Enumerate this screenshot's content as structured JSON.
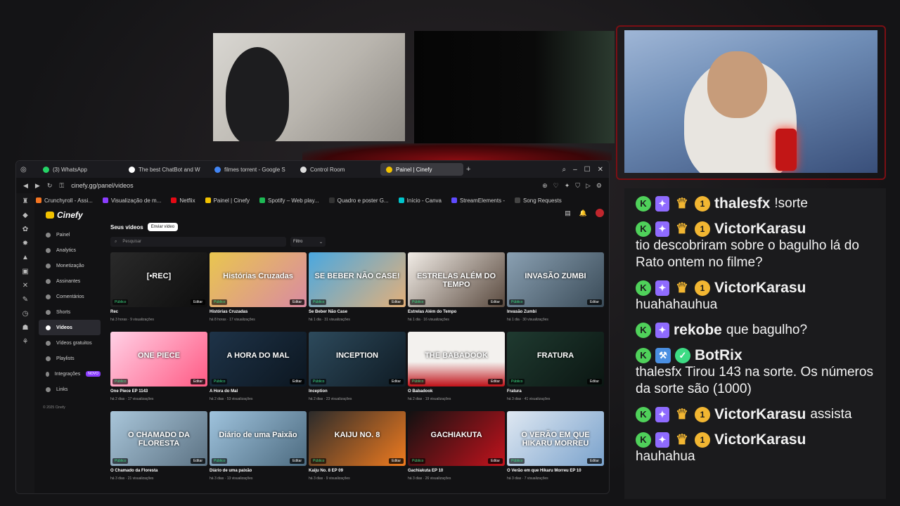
{
  "browser": {
    "tabs": [
      {
        "label": "(3) WhatsApp",
        "color": "#25d366"
      },
      {
        "label": "The best ChatBot and W",
        "color": "#ffffff"
      },
      {
        "label": "filmes torrent - Google S",
        "color": "#4285f4"
      },
      {
        "label": "Control Room",
        "color": "#dddddd"
      },
      {
        "label": "Painel | Cinefy",
        "color": "#f2c200"
      }
    ],
    "url": "cinefy.gg/panel/videos",
    "bookmarks": [
      {
        "label": "Crunchyroll - Assi...",
        "color": "#f47521"
      },
      {
        "label": "Visualização de m...",
        "color": "#8b3dff"
      },
      {
        "label": "Netflix",
        "color": "#e50914"
      },
      {
        "label": "Painel | Cinefy",
        "color": "#f2c200"
      },
      {
        "label": "Spotify – Web play...",
        "color": "#1db954"
      },
      {
        "label": "Quadro e poster G...",
        "color": "#333333"
      },
      {
        "label": "Início - Canva",
        "color": "#00c4cc"
      },
      {
        "label": "StreamElements -",
        "color": "#5f4bff"
      },
      {
        "label": "Song Requests",
        "color": "#444444"
      }
    ]
  },
  "app": {
    "logo": "Cinefy",
    "nav": [
      {
        "label": "Painel"
      },
      {
        "label": "Analytics"
      },
      {
        "label": "Monetização"
      },
      {
        "label": "Assinantes"
      },
      {
        "label": "Comentários"
      },
      {
        "label": "Shorts"
      },
      {
        "label": "Vídeos"
      },
      {
        "label": "Vídeos gratuitos"
      },
      {
        "label": "Playlists"
      },
      {
        "label": "Integrações"
      },
      {
        "label": "Links"
      }
    ],
    "new_badge": "NOVO",
    "copyright": "© 2025 Cinefy",
    "section_title": "Seus vídeos",
    "send_button": "Enviar vídeo",
    "search_placeholder": "Pesquisar",
    "filter_label": "Filtro",
    "public_label": "Público",
    "edit_label": "Editar",
    "videos": [
      {
        "title": "Rec",
        "meta": "há 3 horas · 9 visualizações",
        "overlay": "[•REC]",
        "bg": "linear-gradient(135deg,#2a2a2a,#0e0e0e)"
      },
      {
        "title": "Histórias Cruzadas",
        "meta": "há 8 horas · 17 visualizações",
        "overlay": "Histórias Cruzadas",
        "bg": "linear-gradient(135deg,#e9c64f,#d98aa2)"
      },
      {
        "title": "Se Beber Não Case",
        "meta": "há 1 dia · 31 visualizações",
        "overlay": "SE BEBER NÃO CASE!",
        "bg": "linear-gradient(135deg,#4aa8e0,#e3b07a)"
      },
      {
        "title": "Estrelas Além do Tempo",
        "meta": "há 1 dia · 16 visualizações",
        "overlay": "ESTRELAS ALÉM DO TEMPO",
        "bg": "linear-gradient(135deg,#f1ece6,#5a4a3f)"
      },
      {
        "title": "Invasão Zumbi",
        "meta": "há 1 dia · 30 visualizações",
        "overlay": "INVASÃO ZUMBI",
        "bg": "linear-gradient(135deg,#8aa0b2,#3a4b58)"
      },
      {
        "title": "One Piece EP 1143",
        "meta": "há 2 dias · 17 visualizações",
        "overlay": "ONE PIECE",
        "bg": "linear-gradient(135deg,#ffd1e6,#ff5a84)"
      },
      {
        "title": "A Hora do Mal",
        "meta": "há 2 dias · 53 visualizações",
        "overlay": "A HORA DO MAL",
        "bg": "linear-gradient(135deg,#1e3348,#0c1620)"
      },
      {
        "title": "Inception",
        "meta": "há 2 dias · 23 visualizações",
        "overlay": "INCEPTION",
        "bg": "linear-gradient(135deg,#2d4a5c,#0f1b24)"
      },
      {
        "title": "O Babadook",
        "meta": "há 2 dias · 19 visualizações",
        "overlay": "THE BABADOOK",
        "bg": "linear-gradient(180deg,#f3f1ee,#f3f1ee 55%,#c01118 100%)"
      },
      {
        "title": "Fratura",
        "meta": "há 3 dias · 41 visualizações",
        "overlay": "FRATURA",
        "bg": "linear-gradient(135deg,#1f3a30,#0b1612)"
      },
      {
        "title": "O Chamado da Floresta",
        "meta": "há 3 dias · 21 visualizações",
        "overlay": "O CHAMADO DA FLORESTA",
        "bg": "linear-gradient(135deg,#a9c6da,#5c7283)"
      },
      {
        "title": "Diário de uma paixão",
        "meta": "há 3 dias · 13 visualizações",
        "overlay": "Diário de uma Paixão",
        "bg": "linear-gradient(135deg,#9fc3dd,#4d6b80)"
      },
      {
        "title": "Kaiju No. 8 EP 09",
        "meta": "há 3 dias · 9 visualizações",
        "overlay": "KAIJU NO. 8",
        "bg": "linear-gradient(135deg,#2b2b2b,#f07b1f)"
      },
      {
        "title": "Gachiakuta EP 10",
        "meta": "há 3 dias · 26 visualizações",
        "overlay": "GACHIAKUTA",
        "bg": "linear-gradient(135deg,#111,#c2131d)"
      },
      {
        "title": "O Verão em que Hikaru Morreu EP 10",
        "meta": "há 3 dias · 7 visualizações",
        "overlay": "O VERÃO EM QUE HIKARU MORREU",
        "bg": "linear-gradient(135deg,#dfe8f2,#7aa2cc)"
      }
    ]
  },
  "chat": [
    {
      "user": "thalesfx",
      "text": "!sorte",
      "user_color": "#f2f2f2"
    },
    {
      "user": "VictorKarasu",
      "text": "tio descobriram sobre o bagulho lá do Rato ontem no filme?",
      "user_color": "#f2f2f2"
    },
    {
      "user": "VictorKarasu",
      "text": "huahahauhua",
      "user_color": "#f2f2f2"
    },
    {
      "user": "rekobe",
      "text": "que bagulho?",
      "user_color": "#f2f2f2"
    },
    {
      "user": "BotRix",
      "text": "thalesfx Tirou 143 na sorte. Os números da sorte são (1000)",
      "user_color": "#f2f2f2"
    },
    {
      "user": "VictorKarasu",
      "text": "assista",
      "user_color": "#f2f2f2"
    },
    {
      "user": "VictorKarasu",
      "text": "hauhahua",
      "user_color": "#f2f2f2"
    }
  ]
}
